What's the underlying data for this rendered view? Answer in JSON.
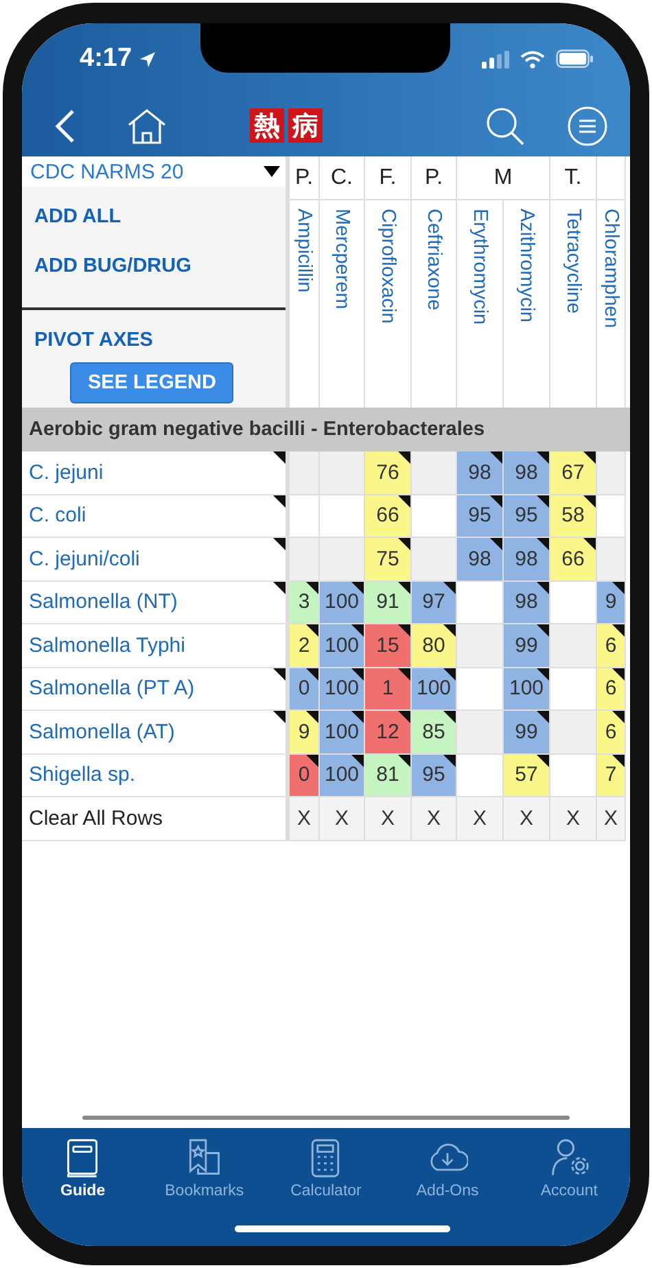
{
  "status_bar": {
    "time": "4:17"
  },
  "nav": {
    "logo": [
      "熱",
      "病"
    ]
  },
  "panel": {
    "dataset": "CDC NARMS 20",
    "actions": [
      "ADD ALL",
      "ADD BUG/DRUG"
    ],
    "pivot": "PIVOT AXES",
    "legend_button": "SEE LEGEND"
  },
  "drug_groups": [
    {
      "label": "P.",
      "drugs": [
        "Ampicillin"
      ]
    },
    {
      "label": "C.",
      "drugs": [
        "Mercperem"
      ]
    },
    {
      "label": "F.",
      "drugs": [
        "Ciprofloxacin"
      ]
    },
    {
      "label": "P.",
      "drugs": [
        "Ceftriaxone"
      ]
    },
    {
      "label": "M",
      "drugs": [
        "Erythromycin",
        "Azithromycin"
      ]
    },
    {
      "label": "T.",
      "drugs": [
        "Tetracycline"
      ]
    },
    {
      "drugs": [
        "Chloramphen"
      ]
    }
  ],
  "section": "Aerobic gram negative bacilli - Enterobacterales",
  "rows": [
    {
      "name": "C. jejuni",
      "note": true,
      "cells": [
        null,
        null,
        {
          "value": "76",
          "color": "#fbf68a"
        },
        null,
        {
          "value": "98",
          "color": "#8fb4e3"
        },
        {
          "value": "98",
          "color": "#8fb4e3"
        },
        {
          "value": "67",
          "color": "#fbf68a"
        },
        null
      ]
    },
    {
      "name": "C. coli",
      "note": true,
      "cells": [
        null,
        null,
        {
          "value": "66",
          "color": "#fbf68a"
        },
        null,
        {
          "value": "95",
          "color": "#8fb4e3"
        },
        {
          "value": "95",
          "color": "#8fb4e3"
        },
        {
          "value": "58",
          "color": "#fbf68a"
        },
        null
      ]
    },
    {
      "name": "C. jejuni/coli",
      "note": true,
      "cells": [
        null,
        null,
        {
          "value": "75",
          "color": "#fbf68a"
        },
        null,
        {
          "value": "98",
          "color": "#8fb4e3"
        },
        {
          "value": "98",
          "color": "#8fb4e3"
        },
        {
          "value": "66",
          "color": "#fbf68a"
        },
        null
      ]
    },
    {
      "name": "Salmonella (NT)",
      "note": true,
      "cells": [
        {
          "value": "3",
          "color": "#c5f4c0"
        },
        {
          "value": "100",
          "color": "#8fb4e3"
        },
        {
          "value": "91",
          "color": "#c5f4c0"
        },
        {
          "value": "97",
          "color": "#8fb4e3"
        },
        null,
        {
          "value": "98",
          "color": "#8fb4e3"
        },
        null,
        {
          "value": "9",
          "color": "#8fb4e3"
        }
      ]
    },
    {
      "name": "Salmonella Typhi",
      "note": false,
      "cells": [
        {
          "value": "2",
          "color": "#fbf68a"
        },
        {
          "value": "100",
          "color": "#8fb4e3"
        },
        {
          "value": "15",
          "color": "#f07070"
        },
        {
          "value": "80",
          "color": "#fbf68a"
        },
        null,
        {
          "value": "99",
          "color": "#8fb4e3"
        },
        null,
        {
          "value": "6",
          "color": "#fbf68a"
        }
      ]
    },
    {
      "name": "Salmonella (PT A)",
      "note": true,
      "cells": [
        {
          "value": "0",
          "color": "#8fb4e3"
        },
        {
          "value": "100",
          "color": "#8fb4e3"
        },
        {
          "value": "1",
          "color": "#f07070"
        },
        {
          "value": "100",
          "color": "#8fb4e3"
        },
        null,
        {
          "value": "100",
          "color": "#8fb4e3"
        },
        null,
        {
          "value": "6",
          "color": "#fbf68a"
        }
      ]
    },
    {
      "name": "Salmonella (AT)",
      "note": true,
      "cells": [
        {
          "value": "9",
          "color": "#fbf68a"
        },
        {
          "value": "100",
          "color": "#8fb4e3"
        },
        {
          "value": "12",
          "color": "#f07070"
        },
        {
          "value": "85",
          "color": "#c5f4c0"
        },
        null,
        {
          "value": "99",
          "color": "#8fb4e3"
        },
        null,
        {
          "value": "6",
          "color": "#fbf68a"
        }
      ]
    },
    {
      "name": "Shigella sp.",
      "note": false,
      "cells": [
        {
          "value": "0",
          "color": "#f07070"
        },
        {
          "value": "100",
          "color": "#8fb4e3"
        },
        {
          "value": "81",
          "color": "#c5f4c0"
        },
        {
          "value": "95",
          "color": "#8fb4e3"
        },
        null,
        {
          "value": "57",
          "color": "#fbf68a"
        },
        null,
        {
          "value": "7",
          "color": "#fbf68a"
        }
      ]
    }
  ],
  "clear_row": {
    "label": "Clear All Rows",
    "cells": [
      "X",
      "X",
      "X",
      "X",
      "X",
      "X",
      "X",
      "X"
    ]
  },
  "tabs": [
    {
      "label": "Guide",
      "selected": true
    },
    {
      "label": "Bookmarks",
      "selected": false
    },
    {
      "label": "Calculator",
      "selected": false
    },
    {
      "label": "Add-Ons",
      "selected": false
    },
    {
      "label": "Account",
      "selected": false
    }
  ]
}
